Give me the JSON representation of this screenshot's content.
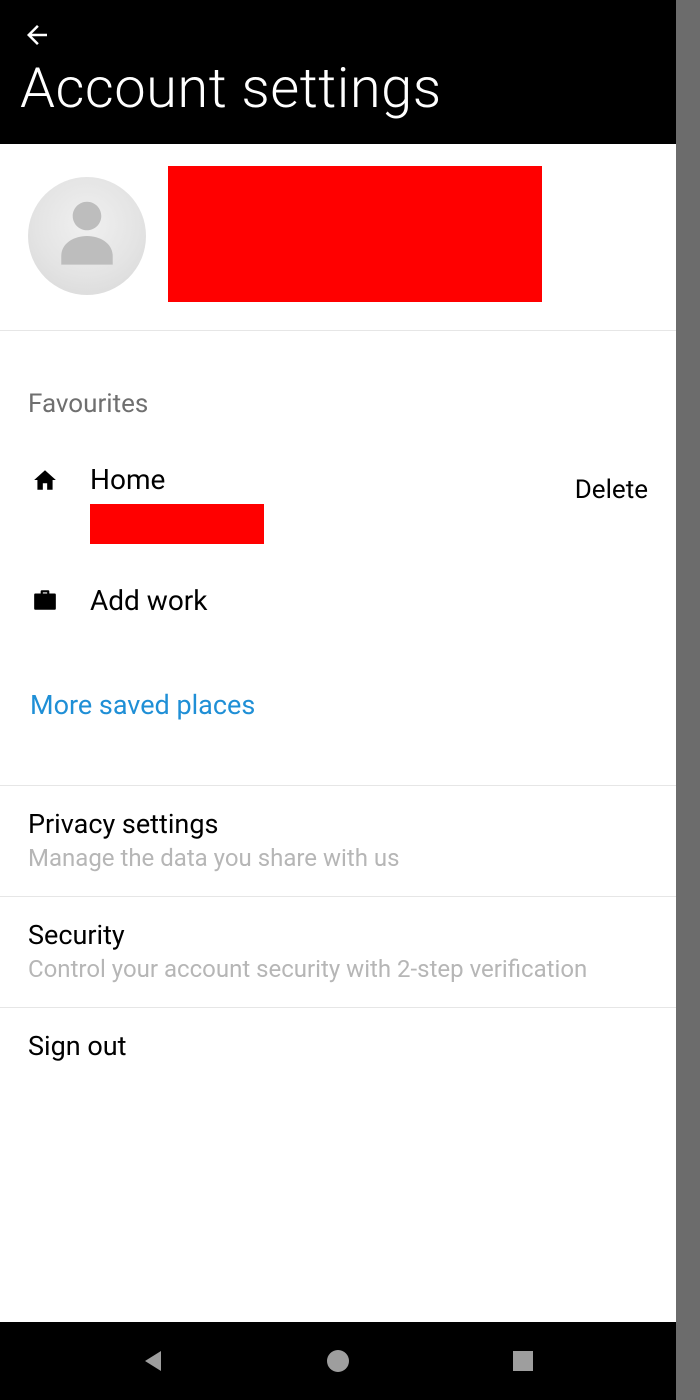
{
  "header": {
    "title": "Account settings"
  },
  "favourites": {
    "section_label": "Favourites",
    "home_label": "Home",
    "delete_label": "Delete",
    "add_work_label": "Add work",
    "more_label": "More saved places"
  },
  "items": {
    "privacy": {
      "title": "Privacy settings",
      "subtitle": "Manage the data you share with us"
    },
    "security": {
      "title": "Security",
      "subtitle": "Control your account security with 2-step verification"
    },
    "signout": {
      "title": "Sign out"
    }
  },
  "colors": {
    "accent_link": "#1f8fd6",
    "redaction": "#ff0000"
  }
}
